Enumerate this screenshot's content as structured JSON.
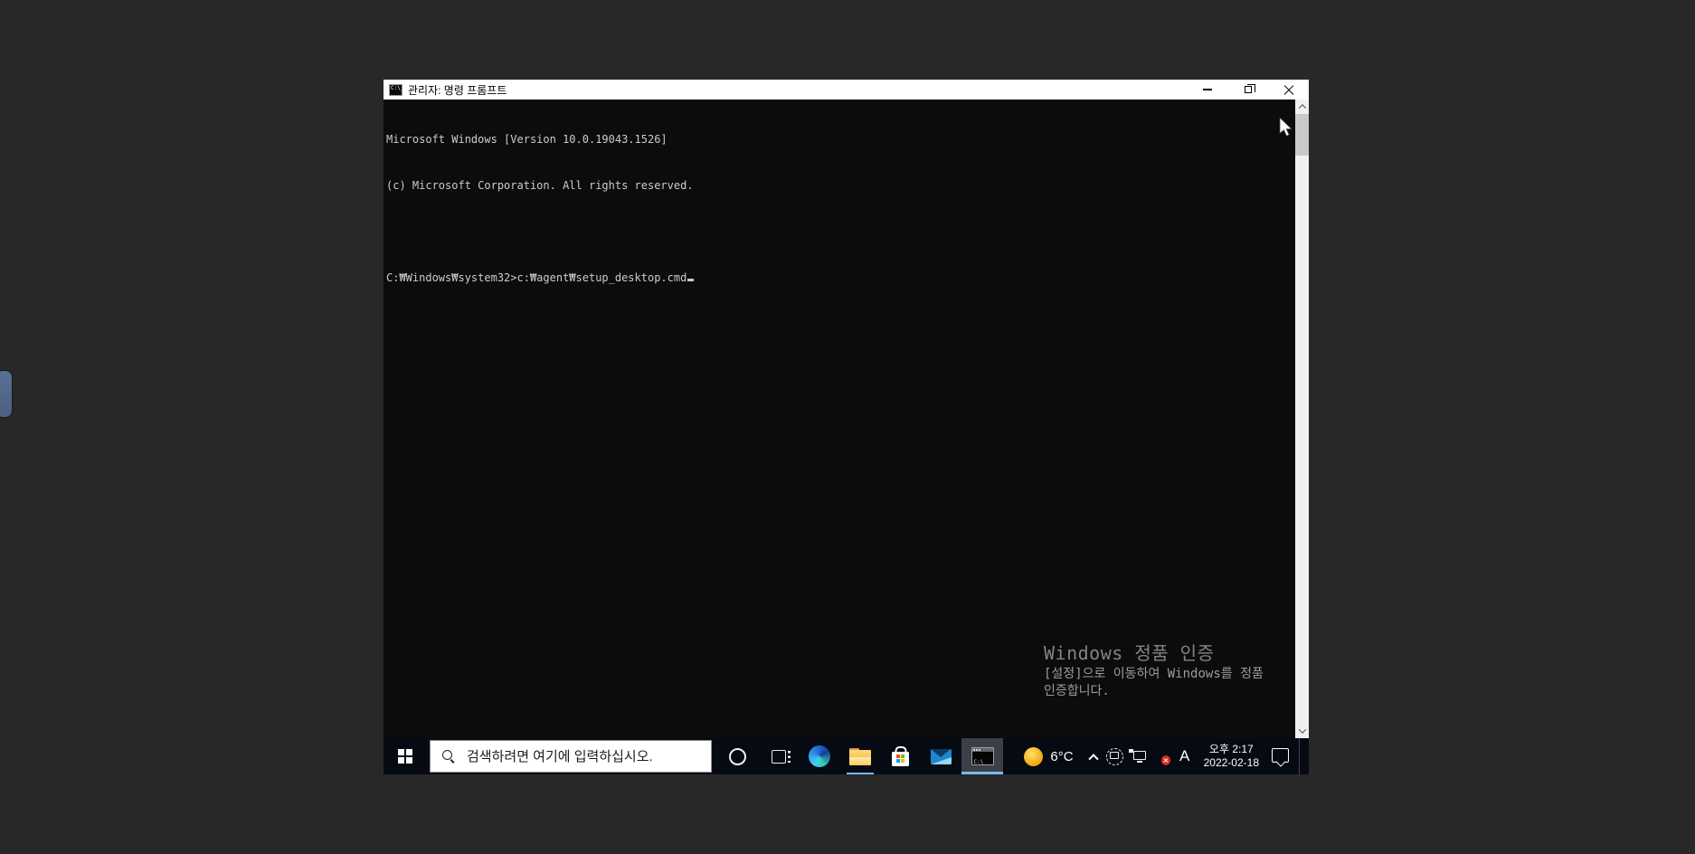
{
  "colors": {
    "desktop_bg": "#282828",
    "console_bg": "#0c0c0c",
    "console_text": "#cccccc",
    "taskbar_bg": "#060a13",
    "accent_underline": "#76b9ed",
    "mute_badge": "#e0281e",
    "sun_icon": "#f2a200",
    "side_tab": "#56688c"
  },
  "window": {
    "title": "관리자: 명령 프롬프트",
    "icon_text": "C:\\_"
  },
  "console": {
    "lines": [
      "Microsoft Windows [Version 10.0.19043.1526]",
      "(c) Microsoft Corporation. All rights reserved.",
      "",
      "C:₩Windows₩system32>c:₩agent₩setup_desktop.cmd"
    ]
  },
  "watermark": {
    "title": "Windows 정품 인증",
    "body_line1": "[설정]으로 이동하여 Windows를 정품",
    "body_line2": "인증합니다."
  },
  "taskbar": {
    "search_placeholder": "검색하려면 여기에 입력하십시오.",
    "app_icons": [
      "start",
      "cortana",
      "task-view",
      "edge",
      "file-explorer",
      "store",
      "mail",
      "command-prompt"
    ],
    "tray_icons": [
      "weather-sun",
      "hidden-icons-chevron",
      "meet-now",
      "ethernet-network",
      "volume-muted",
      "ime-indicator",
      "clock",
      "action-center",
      "show-desktop"
    ],
    "weather_temp": "6°C",
    "ime_indicator": "A",
    "clock_time": "오후 2:17",
    "clock_date": "2022-02-18"
  }
}
